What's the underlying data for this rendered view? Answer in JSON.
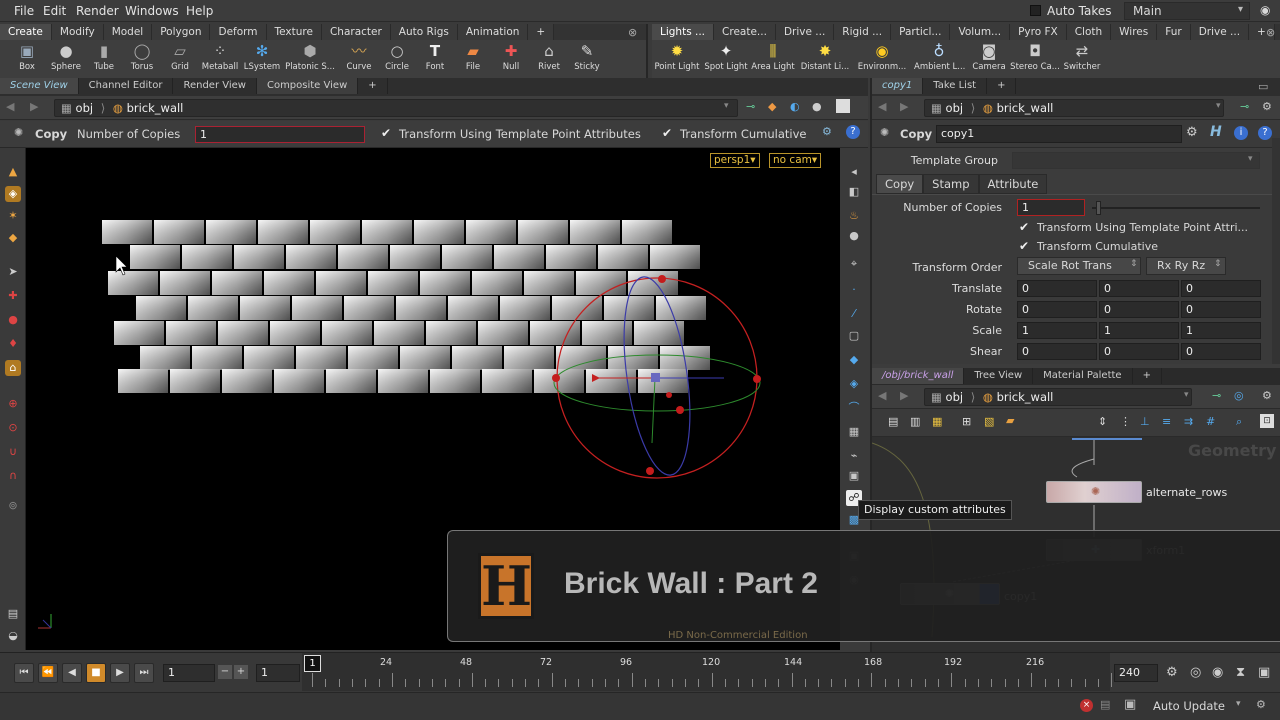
{
  "menu": [
    "File",
    "Edit",
    "Render",
    "Windows",
    "Help"
  ],
  "takes": {
    "label": "Auto Takes",
    "current": "Main"
  },
  "shelf_left": {
    "tabs": [
      "Create",
      "Modify",
      "Model",
      "Polygon",
      "Deform",
      "Texture",
      "Character",
      "Auto Rigs",
      "Animation",
      "+"
    ],
    "tools": [
      "Box",
      "Sphere",
      "Tube",
      "Torus",
      "Grid",
      "Metaball",
      "LSystem",
      "Platonic S...",
      "Curve",
      "Circle",
      "Font",
      "File",
      "Null",
      "Rivet",
      "Sticky"
    ]
  },
  "shelf_right": {
    "tabs": [
      "Lights ...",
      "Create...",
      "Drive ...",
      "Rigid ...",
      "Particl...",
      "Volum...",
      "Pyro FX",
      "Cloth",
      "Wires",
      "Fur",
      "Drive ...",
      "+"
    ],
    "tools": [
      "Point Light",
      "Spot Light",
      "Area Light",
      "Distant Li...",
      "Environm...",
      "Ambient L...",
      "Camera",
      "Stereo Ca...",
      "Switcher"
    ]
  },
  "left_pane": {
    "tabs": [
      "Scene View",
      "Channel Editor",
      "Render View",
      "Composite View",
      "+"
    ],
    "path": {
      "root": "obj",
      "node": "brick_wall"
    },
    "op": {
      "name": "Copy",
      "num_label": "Number of Copies",
      "num_value": "1",
      "check1": "Transform Using Template Point Attributes",
      "check2": "Transform Cumulative"
    },
    "viewport": {
      "camera": "persp1",
      "cam": "no cam"
    }
  },
  "right_top": {
    "tabs": [
      "copy1",
      "Take List",
      "+"
    ],
    "path": {
      "root": "obj",
      "node": "brick_wall"
    },
    "node_type": "Copy",
    "node_name": "copy1",
    "template_group_label": "Template Group",
    "subtabs": [
      "Copy",
      "Stamp",
      "Attribute"
    ],
    "params": {
      "num_copies_label": "Number of Copies",
      "num_copies": "1",
      "check1": "Transform Using Template Point Attri...",
      "check2": "Transform Cumulative",
      "order_label": "Transform Order",
      "order1": "Scale Rot Trans",
      "order2": "Rx Ry Rz",
      "rows": [
        {
          "label": "Translate",
          "v": [
            "0",
            "0",
            "0"
          ]
        },
        {
          "label": "Rotate",
          "v": [
            "0",
            "0",
            "0"
          ]
        },
        {
          "label": "Scale",
          "v": [
            "1",
            "1",
            "1"
          ]
        },
        {
          "label": "Shear",
          "v": [
            "0",
            "0",
            "0"
          ]
        }
      ]
    }
  },
  "right_bottom": {
    "tabs": [
      "/obj/brick_wall",
      "Tree View",
      "Material Palette",
      "+"
    ],
    "path": {
      "root": "obj",
      "node": "brick_wall"
    },
    "watermark": "Geometry",
    "nodes": [
      "alternate_rows",
      "xform1",
      "copy1"
    ]
  },
  "tooltip": "Display custom attributes",
  "overlay": {
    "logo": "H",
    "title": "Brick Wall : Part 2",
    "edition": "HD Non-Commercial Edition"
  },
  "timeline": {
    "current": "1",
    "start": "1",
    "end": "240",
    "ticks": [
      "24",
      "48",
      "72",
      "96",
      "120",
      "144",
      "168",
      "192",
      "216"
    ],
    "frame_marker": "1"
  },
  "status": {
    "update": "Auto Update"
  }
}
